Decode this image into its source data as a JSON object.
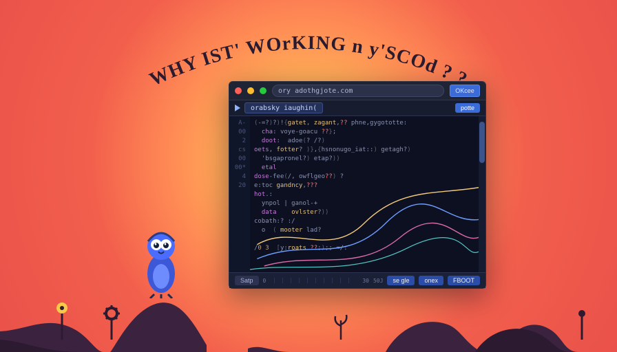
{
  "title_text": "WHY IST' WOrKING n y'SCOd ? ?",
  "window": {
    "address": "ory adothgjote.com",
    "titlebar_button": "OKcee",
    "tab_label": "orabsky iaughin(",
    "subtab_label": "potte",
    "footer_left": "Satp",
    "footer_btn1": "se gle",
    "footer_btn2": "onex",
    "footer_btn3": "FBOOT",
    "tick_mid": "30",
    "tick_right": "50J"
  },
  "gutter": [
    "A-",
    "00",
    "2",
    "",
    "cs",
    "",
    "",
    "",
    "00",
    "",
    "",
    "00*",
    "4",
    "",
    "",
    "",
    "20"
  ],
  "code_lines": [
    {
      "raw": "(-=?)?)!{gatet, zagant,?? phne,gygototte:"
    },
    {
      "raw": "  cha: voye-goacu ??};"
    },
    {
      "raw": "  doot:  adoe(? /?)"
    },
    {
      "raw": "oets, fotter? )},{hsnonugo_iat::) getagh?)"
    },
    {
      "raw": "  'bsgapronel?) etap?))"
    },
    {
      "raw": "  etal"
    },
    {
      "raw": "dose-fee(/, owflgeo??) ?"
    },
    {
      "raw": "e:toc gandncy,???"
    },
    {
      "raw": "hot.:"
    },
    {
      "raw": "  ynpol | ganol-+"
    },
    {
      "raw": "  data    ovlster?))"
    },
    {
      "raw": "cobath:? :/"
    },
    {
      "raw": "  o  ( mooter lad?"
    },
    {
      "raw": ""
    },
    {
      "raw": "/0 3  [y:roats ??;);; =/:"
    }
  ],
  "colors": {
    "accent": "#3b6bd6",
    "editor_bg": "#0c1020",
    "bird": "#4a6cff"
  }
}
